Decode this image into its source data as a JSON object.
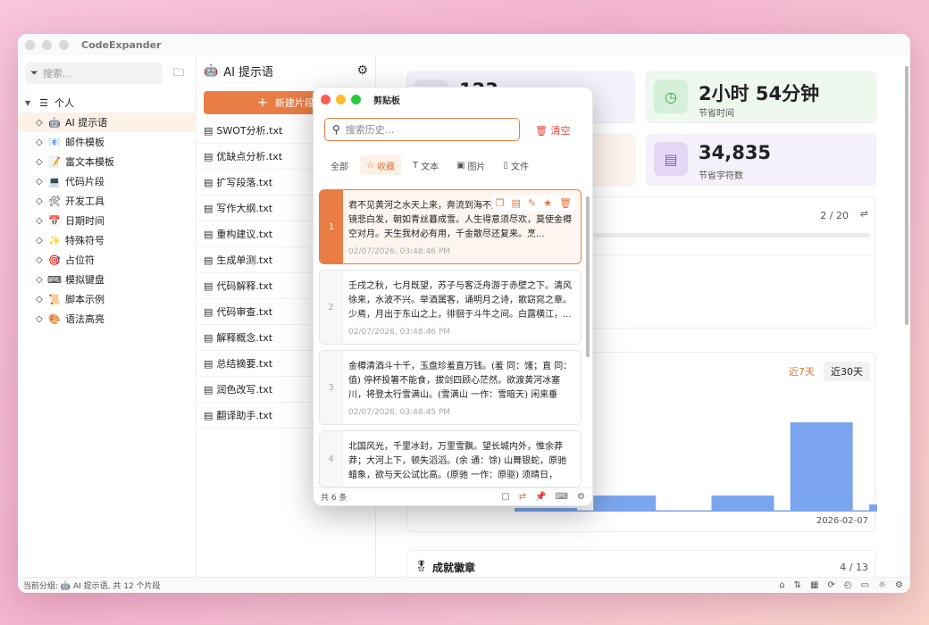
{
  "app": {
    "title": "CodeExpander"
  },
  "sidebar": {
    "search_placeholder": "搜索...",
    "group": {
      "icon": "layers-icon",
      "label": "个人"
    },
    "items": [
      {
        "emoji": "🤖",
        "label": "AI 提示语"
      },
      {
        "emoji": "📧",
        "label": "邮件模板"
      },
      {
        "emoji": "📝",
        "label": "富文本模板"
      },
      {
        "emoji": "💻",
        "label": "代码片段"
      },
      {
        "emoji": "🛠",
        "label": "开发工具"
      },
      {
        "emoji": "📅",
        "label": "日期时间"
      },
      {
        "emoji": "✨",
        "label": "特殊符号"
      },
      {
        "emoji": "🎯",
        "label": "占位符"
      },
      {
        "emoji": "⌨",
        "label": "模拟键盘"
      },
      {
        "emoji": "📜",
        "label": "脚本示例"
      },
      {
        "emoji": "🎨",
        "label": "语法高亮"
      }
    ]
  },
  "list": {
    "header_emoji": "🤖",
    "header": "AI 提示语",
    "new_button": "新建片段",
    "files": [
      "SWOT分析.txt",
      "优缺点分析.txt",
      "扩写段落.txt",
      "写作大纲.txt",
      "重构建议.txt",
      "生成单测.txt",
      "代码解释.txt",
      "代码审查.txt",
      "解释概念.txt",
      "总结摘要.txt",
      "润色改写.txt",
      "翻译助手.txt"
    ]
  },
  "dashboard": {
    "stat1_num": "123",
    "stat2_num": "2小时 54分钟",
    "stat2_label": "节省时间",
    "stat4_num": "34,835",
    "stat4_label": "节省字符数",
    "paging": "2 / 20",
    "chart": {
      "tab7": "近7天",
      "tab30": "近30天",
      "date": "2026-02-07"
    },
    "badges": {
      "title": "成就徽章",
      "count": "4 / 13",
      "b1": "🌱",
      "b2": "💯",
      "b3": "⭐",
      "b4": "🏆"
    }
  },
  "chart_data": {
    "type": "bar",
    "values": [
      4,
      1,
      18,
      0,
      1,
      18,
      1,
      100,
      0,
      8
    ],
    "ylim": [
      0,
      100
    ]
  },
  "status": {
    "text": "当前分组: 🤖 AI 提示语, 共 12 个片段"
  },
  "popup": {
    "title": "剪贴板",
    "search_placeholder": "搜索历史...",
    "clear": "清空",
    "tabs": [
      "全部",
      "收藏",
      "文本",
      "图片",
      "文件"
    ],
    "clips": [
      {
        "n": "1",
        "text": "君不见黄河之水天上来，奔流到海不复回。君不见高堂明镜悲白发，朝如青丝暮成雪。人生得意须尽欢，莫使金樽空对月。天生我材必有用，千金散尽还复来。烹...",
        "time": "02/07/2026, 03:48:46 PM"
      },
      {
        "n": "2",
        "text": "壬戌之秋，七月既望，苏子与客泛舟游于赤壁之下。清风徐来，水波不兴。举酒属客，诵明月之诗，歌窈窕之章。少焉，月出于东山之上，徘徊于斗牛之间。白露横江，...",
        "time": "02/07/2026, 03:48:46 PM"
      },
      {
        "n": "3",
        "text": "金樽清酒斗十千，玉盘珍羞直万钱。(羞 同：馐；直 同：值) 停杯投箸不能食，拔剑四顾心茫然。欲渡黄河冰塞川，将登太行雪满山。(雪满山 一作：雪暗天) 闲来垂钓...",
        "time": "02/07/2026, 03:48:45 PM"
      },
      {
        "n": "4",
        "text": "北国风光，千里冰封，万里雪飘。望长城内外，惟余莽莽；大河上下，顿失滔滔。(余 通：馀) 山舞银蛇，原驰蜡象，欲与天公试比高。(原驰 一作：原驱) 须晴日，看...",
        "time": ""
      }
    ],
    "footer": "共 6 条"
  }
}
